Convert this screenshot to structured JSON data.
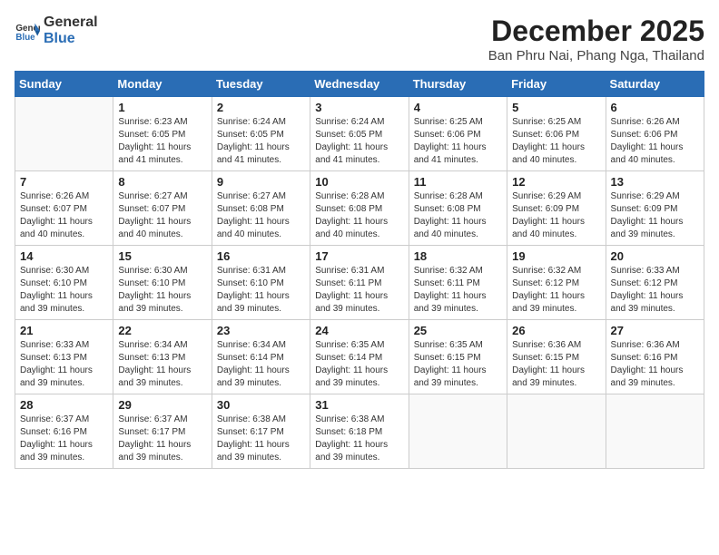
{
  "logo": {
    "text_general": "General",
    "text_blue": "Blue"
  },
  "title": {
    "month": "December 2025",
    "location": "Ban Phru Nai, Phang Nga, Thailand"
  },
  "weekdays": [
    "Sunday",
    "Monday",
    "Tuesday",
    "Wednesday",
    "Thursday",
    "Friday",
    "Saturday"
  ],
  "weeks": [
    [
      {
        "day": "",
        "sunrise": "",
        "sunset": "",
        "daylight": ""
      },
      {
        "day": "1",
        "sunrise": "Sunrise: 6:23 AM",
        "sunset": "Sunset: 6:05 PM",
        "daylight": "Daylight: 11 hours and 41 minutes."
      },
      {
        "day": "2",
        "sunrise": "Sunrise: 6:24 AM",
        "sunset": "Sunset: 6:05 PM",
        "daylight": "Daylight: 11 hours and 41 minutes."
      },
      {
        "day": "3",
        "sunrise": "Sunrise: 6:24 AM",
        "sunset": "Sunset: 6:05 PM",
        "daylight": "Daylight: 11 hours and 41 minutes."
      },
      {
        "day": "4",
        "sunrise": "Sunrise: 6:25 AM",
        "sunset": "Sunset: 6:06 PM",
        "daylight": "Daylight: 11 hours and 41 minutes."
      },
      {
        "day": "5",
        "sunrise": "Sunrise: 6:25 AM",
        "sunset": "Sunset: 6:06 PM",
        "daylight": "Daylight: 11 hours and 40 minutes."
      },
      {
        "day": "6",
        "sunrise": "Sunrise: 6:26 AM",
        "sunset": "Sunset: 6:06 PM",
        "daylight": "Daylight: 11 hours and 40 minutes."
      }
    ],
    [
      {
        "day": "7",
        "sunrise": "Sunrise: 6:26 AM",
        "sunset": "Sunset: 6:07 PM",
        "daylight": "Daylight: 11 hours and 40 minutes."
      },
      {
        "day": "8",
        "sunrise": "Sunrise: 6:27 AM",
        "sunset": "Sunset: 6:07 PM",
        "daylight": "Daylight: 11 hours and 40 minutes."
      },
      {
        "day": "9",
        "sunrise": "Sunrise: 6:27 AM",
        "sunset": "Sunset: 6:08 PM",
        "daylight": "Daylight: 11 hours and 40 minutes."
      },
      {
        "day": "10",
        "sunrise": "Sunrise: 6:28 AM",
        "sunset": "Sunset: 6:08 PM",
        "daylight": "Daylight: 11 hours and 40 minutes."
      },
      {
        "day": "11",
        "sunrise": "Sunrise: 6:28 AM",
        "sunset": "Sunset: 6:08 PM",
        "daylight": "Daylight: 11 hours and 40 minutes."
      },
      {
        "day": "12",
        "sunrise": "Sunrise: 6:29 AM",
        "sunset": "Sunset: 6:09 PM",
        "daylight": "Daylight: 11 hours and 40 minutes."
      },
      {
        "day": "13",
        "sunrise": "Sunrise: 6:29 AM",
        "sunset": "Sunset: 6:09 PM",
        "daylight": "Daylight: 11 hours and 39 minutes."
      }
    ],
    [
      {
        "day": "14",
        "sunrise": "Sunrise: 6:30 AM",
        "sunset": "Sunset: 6:10 PM",
        "daylight": "Daylight: 11 hours and 39 minutes."
      },
      {
        "day": "15",
        "sunrise": "Sunrise: 6:30 AM",
        "sunset": "Sunset: 6:10 PM",
        "daylight": "Daylight: 11 hours and 39 minutes."
      },
      {
        "day": "16",
        "sunrise": "Sunrise: 6:31 AM",
        "sunset": "Sunset: 6:10 PM",
        "daylight": "Daylight: 11 hours and 39 minutes."
      },
      {
        "day": "17",
        "sunrise": "Sunrise: 6:31 AM",
        "sunset": "Sunset: 6:11 PM",
        "daylight": "Daylight: 11 hours and 39 minutes."
      },
      {
        "day": "18",
        "sunrise": "Sunrise: 6:32 AM",
        "sunset": "Sunset: 6:11 PM",
        "daylight": "Daylight: 11 hours and 39 minutes."
      },
      {
        "day": "19",
        "sunrise": "Sunrise: 6:32 AM",
        "sunset": "Sunset: 6:12 PM",
        "daylight": "Daylight: 11 hours and 39 minutes."
      },
      {
        "day": "20",
        "sunrise": "Sunrise: 6:33 AM",
        "sunset": "Sunset: 6:12 PM",
        "daylight": "Daylight: 11 hours and 39 minutes."
      }
    ],
    [
      {
        "day": "21",
        "sunrise": "Sunrise: 6:33 AM",
        "sunset": "Sunset: 6:13 PM",
        "daylight": "Daylight: 11 hours and 39 minutes."
      },
      {
        "day": "22",
        "sunrise": "Sunrise: 6:34 AM",
        "sunset": "Sunset: 6:13 PM",
        "daylight": "Daylight: 11 hours and 39 minutes."
      },
      {
        "day": "23",
        "sunrise": "Sunrise: 6:34 AM",
        "sunset": "Sunset: 6:14 PM",
        "daylight": "Daylight: 11 hours and 39 minutes."
      },
      {
        "day": "24",
        "sunrise": "Sunrise: 6:35 AM",
        "sunset": "Sunset: 6:14 PM",
        "daylight": "Daylight: 11 hours and 39 minutes."
      },
      {
        "day": "25",
        "sunrise": "Sunrise: 6:35 AM",
        "sunset": "Sunset: 6:15 PM",
        "daylight": "Daylight: 11 hours and 39 minutes."
      },
      {
        "day": "26",
        "sunrise": "Sunrise: 6:36 AM",
        "sunset": "Sunset: 6:15 PM",
        "daylight": "Daylight: 11 hours and 39 minutes."
      },
      {
        "day": "27",
        "sunrise": "Sunrise: 6:36 AM",
        "sunset": "Sunset: 6:16 PM",
        "daylight": "Daylight: 11 hours and 39 minutes."
      }
    ],
    [
      {
        "day": "28",
        "sunrise": "Sunrise: 6:37 AM",
        "sunset": "Sunset: 6:16 PM",
        "daylight": "Daylight: 11 hours and 39 minutes."
      },
      {
        "day": "29",
        "sunrise": "Sunrise: 6:37 AM",
        "sunset": "Sunset: 6:17 PM",
        "daylight": "Daylight: 11 hours and 39 minutes."
      },
      {
        "day": "30",
        "sunrise": "Sunrise: 6:38 AM",
        "sunset": "Sunset: 6:17 PM",
        "daylight": "Daylight: 11 hours and 39 minutes."
      },
      {
        "day": "31",
        "sunrise": "Sunrise: 6:38 AM",
        "sunset": "Sunset: 6:18 PM",
        "daylight": "Daylight: 11 hours and 39 minutes."
      },
      {
        "day": "",
        "sunrise": "",
        "sunset": "",
        "daylight": ""
      },
      {
        "day": "",
        "sunrise": "",
        "sunset": "",
        "daylight": ""
      },
      {
        "day": "",
        "sunrise": "",
        "sunset": "",
        "daylight": ""
      }
    ]
  ]
}
